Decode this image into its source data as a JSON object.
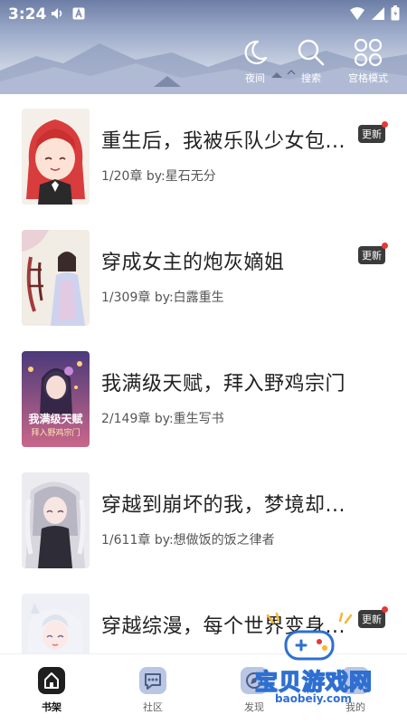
{
  "status_bar": {
    "time": "3:24"
  },
  "header": {
    "actions": [
      {
        "label": "夜间",
        "icon": "moon-icon"
      },
      {
        "label": "搜索",
        "icon": "search-icon"
      },
      {
        "label": "宫格模式",
        "icon": "grid-icon"
      }
    ]
  },
  "books": [
    {
      "title": "重生后，我被乐队少女包...",
      "chapter": "1/20章",
      "author": "by:星石无分",
      "badge": "更新",
      "has_update": true
    },
    {
      "title": "穿成女主的炮灰嫡姐",
      "chapter": "1/309章",
      "author": "by:白露重生",
      "badge": "更新",
      "has_update": true
    },
    {
      "title": "我满级天赋，拜入野鸡宗门",
      "chapter": "2/149章",
      "author": "by:重生写书",
      "badge": "",
      "has_update": false,
      "cover_text": [
        "我满级天赋",
        "拜入野鸡宗门"
      ]
    },
    {
      "title": "穿越到崩坏的我，梦境却...",
      "chapter": "1/611章",
      "author": "by:想做饭的饭之律者",
      "badge": "",
      "has_update": false
    },
    {
      "title": "穿越综漫，每个世界变身...",
      "chapter": "",
      "author": "",
      "badge": "更新",
      "has_update": true
    }
  ],
  "bottom_nav": [
    {
      "label": "书架",
      "icon": "bookshelf-icon",
      "active": true
    },
    {
      "label": "社区",
      "icon": "chat-icon",
      "active": false
    },
    {
      "label": "发现",
      "icon": "discover-icon",
      "active": false
    },
    {
      "label": "我的",
      "icon": "profile-icon",
      "active": false
    }
  ],
  "watermark": {
    "text": "宝贝游戏网",
    "url": "baobeiy.com"
  },
  "colors": {
    "badge_bg": "#3b3b3b",
    "update_dot": "#e53935",
    "header_sky": "#9eaccb"
  }
}
